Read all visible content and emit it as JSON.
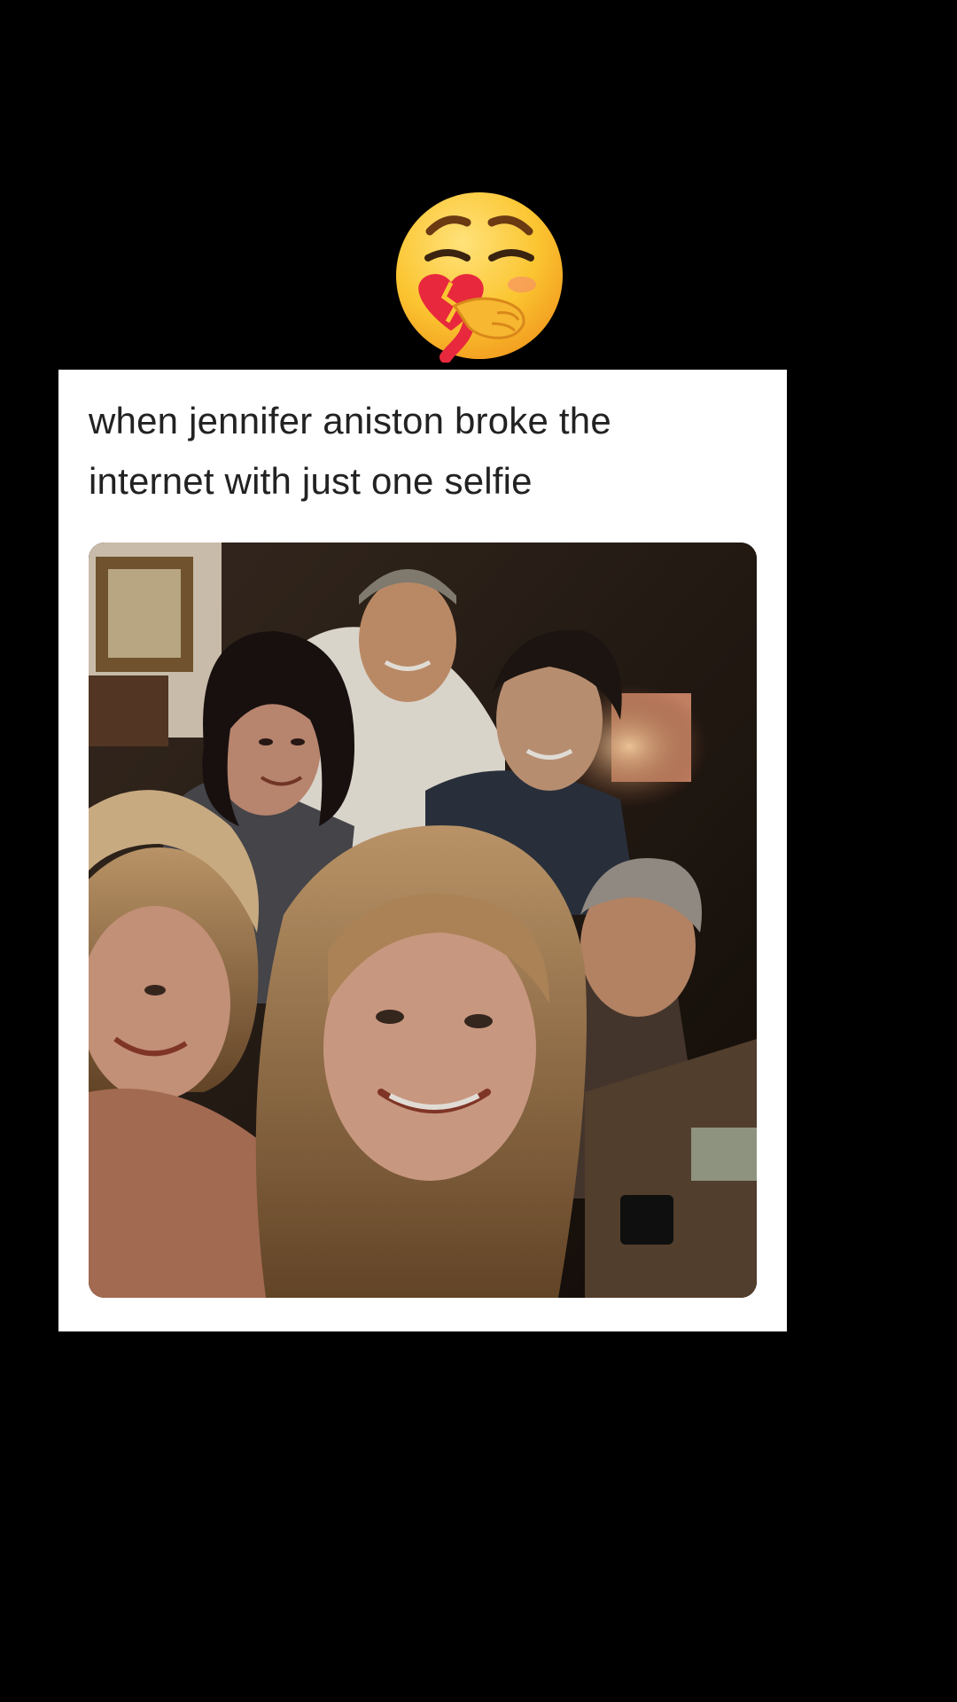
{
  "sticker": {
    "icon": "face-holding-back-tears-with-broken-heart-icon",
    "colors": {
      "face": "#FBC531",
      "heart": "#E8283C"
    }
  },
  "post": {
    "caption": "when jennifer aniston broke the internet with just one selfie",
    "photo_icon": "group-selfie-photo",
    "colors": {
      "card_background": "#ffffff",
      "caption_text": "#222222",
      "page_background": "#000000"
    }
  }
}
